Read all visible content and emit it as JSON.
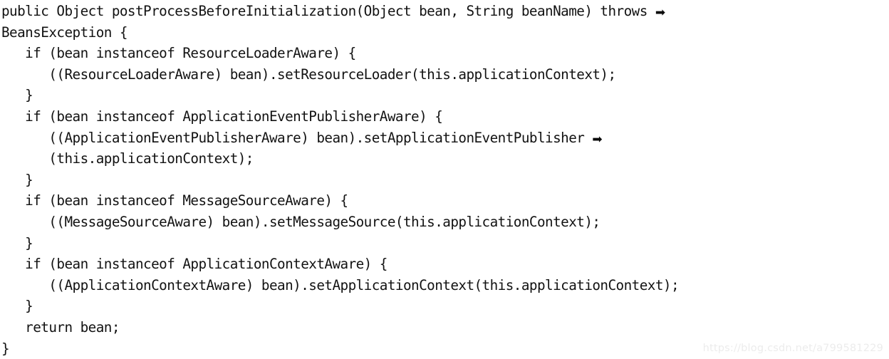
{
  "document": {
    "type": "code-listing",
    "language": "Java",
    "background_color": "#ffffff",
    "text_color": "#121212",
    "continuation_arrow_glyph": "➡"
  },
  "code": {
    "lines": [
      "public Object postProcessBeforeInitialization(Object bean, String beanName) throws ",
      "BeansException {",
      "   if (bean instanceof ResourceLoaderAware) {",
      "      ((ResourceLoaderAware) bean).setResourceLoader(this.applicationContext);",
      "   }",
      "   if (bean instanceof ApplicationEventPublisherAware) {",
      "      ((ApplicationEventPublisherAware) bean).setApplicationEventPublisher ",
      "      (this.applicationContext);",
      "   }",
      "   if (bean instanceof MessageSourceAware) {",
      "      ((MessageSourceAware) bean).setMessageSource(this.applicationContext);",
      "   }",
      "   if (bean instanceof ApplicationContextAware) {",
      "      ((ApplicationContextAware) bean).setApplicationContext(this.applicationContext);",
      "   }",
      "   return bean;",
      "}"
    ],
    "continuation_arrow_on_lines": [
      0,
      6
    ]
  },
  "watermark": {
    "text": "https://blog.csdn.net/a799581229",
    "color": "#ececec"
  }
}
